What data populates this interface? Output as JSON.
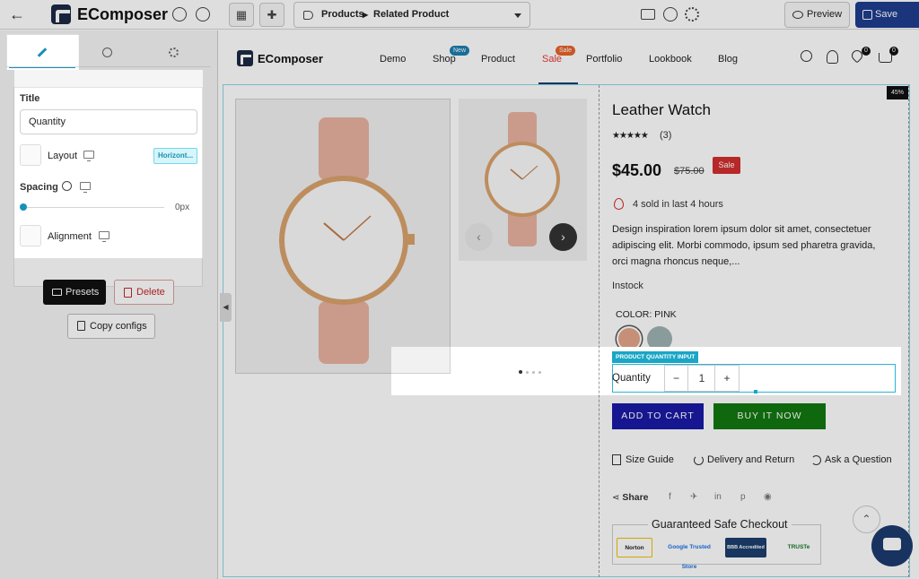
{
  "app": {
    "name": "EComposer"
  },
  "topbar": {
    "breadcrumb": {
      "first": "Products",
      "second": "Related Product"
    },
    "preview_label": "Preview",
    "save_label": "Save"
  },
  "left_panel": {
    "tabs": [
      {
        "id": "content",
        "icon": "pencil-icon",
        "active": true
      },
      {
        "id": "style",
        "icon": "palette-icon",
        "active": false
      },
      {
        "id": "advanced",
        "icon": "gear-icon",
        "active": false
      }
    ],
    "title_label": "Title",
    "title_value": "Quantity",
    "layout_label": "Layout",
    "layout_value": "Horizont...",
    "spacing_label": "Spacing",
    "spacing_value": "0px",
    "spacing_level": 0,
    "alignment_label": "Alignment",
    "presets_label": "Presets",
    "delete_label": "Delete",
    "copy_label": "Copy configs"
  },
  "site": {
    "name": "EComposer",
    "nav": [
      {
        "label": "Demo",
        "badge": null
      },
      {
        "label": "Shop",
        "badge": "New"
      },
      {
        "label": "Product",
        "badge": null
      },
      {
        "label": "Sale",
        "badge": "Sale"
      },
      {
        "label": "Portfolio",
        "badge": null
      },
      {
        "label": "Lookbook",
        "badge": null
      },
      {
        "label": "Blog",
        "badge": null
      }
    ],
    "wishlist_count": "0",
    "cart_count": "0"
  },
  "product": {
    "discount_badge": "45%",
    "title": "Leather Watch",
    "stars": "★★★★★",
    "rating_count": "(3)",
    "price": "$45.00",
    "compare_price": "$75.00",
    "sale_badge": "Sale",
    "sold_text": "4 sold in last 4 hours",
    "description": "Design inspiration lorem ipsum dolor sit amet, consectetuer adipiscing elit. Morbi commodo, ipsum sed pharetra gravida, orci magna rhoncus neque,...",
    "stock": "Instock",
    "color_label": "COLOR: PINK",
    "swatches": [
      "#e4a58a",
      "#9fb3b4"
    ],
    "quantity_element_tag": "PRODUCT QUANTITY INPUT",
    "quantity_label": "Quantity",
    "quantity_value": "1",
    "minus": "−",
    "plus": "+",
    "add_to_cart": "ADD TO CART",
    "buy_now": "BUY IT NOW",
    "size_guide": "Size Guide",
    "delivery": "Delivery and Return",
    "ask": "Ask a Question",
    "share": "Share",
    "secure_title": "Guaranteed Safe Checkout",
    "trust_badges": [
      "Norton",
      "Google Trusted Store",
      "BBB Accredited",
      "TRUSTe"
    ]
  },
  "colors": {
    "accent": "#1890b8",
    "save": "#1e3d8f",
    "sale": "#d32f2f",
    "cart": "#1a1aa6",
    "buy": "#12780f"
  }
}
